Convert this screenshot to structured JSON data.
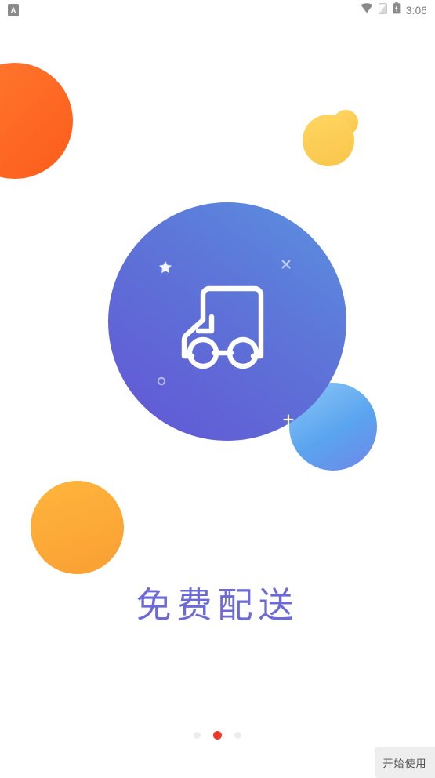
{
  "status_bar": {
    "notification_icon": "app-notification-icon",
    "notification_letter": "A",
    "wifi_icon": "wifi-icon",
    "signal_icon": "cellular-signal-icon",
    "battery_icon": "battery-icon",
    "time": "3:06"
  },
  "decorations": {
    "orange_top_left": {
      "name": "orange-circle-top-left",
      "color": "#fc5c1b"
    },
    "yellow_blob": {
      "name": "yellow-blob-top-right",
      "color": "#ffd662"
    },
    "orange_left": {
      "name": "orange-circle-left",
      "color": "#ffb53d"
    },
    "blue_small": {
      "name": "light-blue-circle",
      "color": "#8cc7f7"
    },
    "hero_circle": {
      "name": "hero-gradient-circle",
      "color_start": "#5b92e2",
      "color_end": "#6355d5"
    },
    "sparkles": [
      {
        "name": "star-sparkle",
        "glyph": "star"
      },
      {
        "name": "x-sparkle",
        "glyph": "x"
      },
      {
        "name": "ring-sparkle",
        "glyph": "ring"
      },
      {
        "name": "plus-sparkle",
        "glyph": "plus"
      }
    ],
    "truck": {
      "name": "delivery-truck-icon",
      "color": "#ffffff"
    }
  },
  "main": {
    "headline": "免费配送",
    "headline_color": "#6c6ad9"
  },
  "pager": {
    "total": 3,
    "active_index": 1,
    "active_color": "#f0392b",
    "inactive_color": "#ececec"
  },
  "cta": {
    "label": "开始使用"
  }
}
